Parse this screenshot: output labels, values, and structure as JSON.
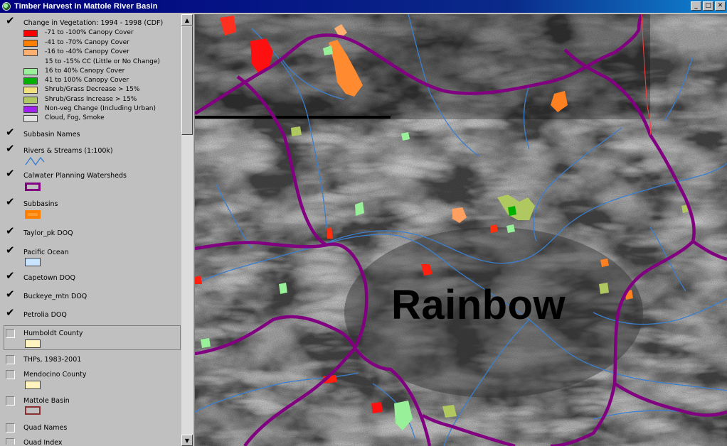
{
  "window": {
    "title": "Timber Harvest in Mattole River Basin"
  },
  "window_buttons": {
    "minimize": "_",
    "maximize": "□",
    "close": "✕"
  },
  "legend": {
    "veg_layer": {
      "title": "Change in Vegetation: 1994 - 1998 (CDF)",
      "classes": [
        {
          "label": "-71 to -100% Canopy Cover",
          "color": "#ff0000"
        },
        {
          "label": "-41 to -70% Canopy Cover",
          "color": "#ff8000"
        },
        {
          "label": "-16 to -40% Canopy Cover",
          "color": "#ffb070"
        },
        {
          "label": "15 to -15% CC (Little or No Change)",
          "color": ""
        },
        {
          "label": "16 to 40% Canopy Cover",
          "color": "#98f098"
        },
        {
          "label": "41 to 100% Canopy Cover",
          "color": "#00b000"
        },
        {
          "label": "Shrub/Grass Decrease > 15%",
          "color": "#f0e080"
        },
        {
          "label": "Shrub/Grass Increase > 15%",
          "color": "#b0c860"
        },
        {
          "label": "Non-veg Change (Including Urban)",
          "color": "#a020f0"
        },
        {
          "label": "Cloud, Fog, Smoke",
          "color": "#e0e0e0"
        }
      ]
    },
    "layers": [
      {
        "name": "Subbasin Names",
        "checked": true
      },
      {
        "name": "Rivers & Streams (1:100k)",
        "checked": true,
        "symbol": "river"
      },
      {
        "name": "Calwater Planning Watersheds",
        "checked": true,
        "symbol": "purple-box"
      },
      {
        "name": "Subbasins",
        "checked": true,
        "symbol": "orange-box"
      },
      {
        "name": "Taylor_pk DOQ",
        "checked": true
      },
      {
        "name": "Pacific Ocean",
        "checked": true,
        "symbol": "blue-box"
      },
      {
        "name": "Capetown DOQ",
        "checked": true
      },
      {
        "name": "Buckeye_mtn DOQ",
        "checked": true
      },
      {
        "name": "Petrolia DOQ",
        "checked": true
      },
      {
        "name": "Humboldt County",
        "checked": false,
        "symbol": "yellow-box"
      },
      {
        "name": "THPs, 1983-2001",
        "checked": false
      },
      {
        "name": "Mendocino County",
        "checked": false,
        "symbol": "yellow-box"
      },
      {
        "name": "Mattole Basin",
        "checked": false,
        "symbol": "brown-box"
      },
      {
        "name": "Quad Names",
        "checked": false
      },
      {
        "name": "Quad Index",
        "checked": false
      }
    ]
  },
  "map": {
    "label": "Rainbow"
  },
  "colors": {
    "watershed": "#800080",
    "river": "#3a7fd0",
    "titlebar": "#000080"
  }
}
